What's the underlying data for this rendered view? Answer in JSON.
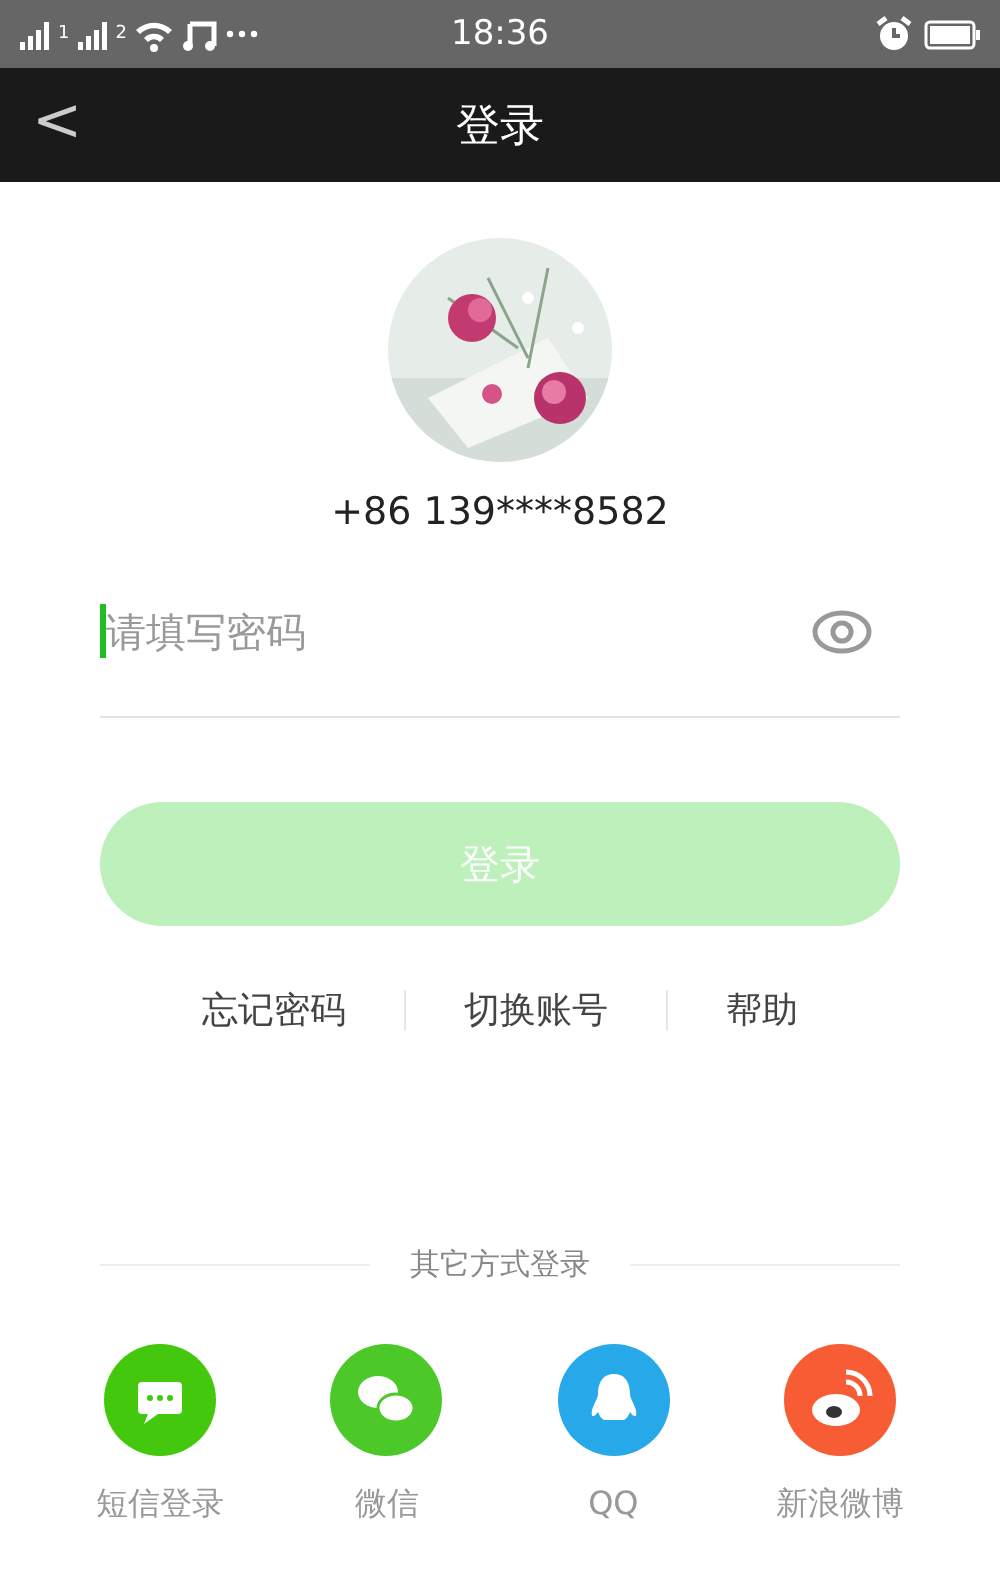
{
  "status_bar": {
    "sim_labels": [
      "1",
      "2"
    ],
    "time": "18:36"
  },
  "nav_bar": {
    "back": "<",
    "title": "登录"
  },
  "account": {
    "kind": "picture",
    "phone": "+86 139****8582"
  },
  "password_field": {
    "placeholder": "请填写密码",
    "focused": true
  },
  "login_button": {
    "label": "登录",
    "disabled": true
  },
  "links": [
    "忘记密码",
    "切换账号",
    "帮助"
  ],
  "other_login": {
    "title": "其它方式登录",
    "options": [
      {
        "kind": "sms",
        "label": "短信登录",
        "color": "#44c80e"
      },
      {
        "kind": "wechat",
        "label": "微信",
        "color": "#4cc928"
      },
      {
        "kind": "qq",
        "label": "QQ",
        "color": "#27a8e8"
      },
      {
        "kind": "weibo",
        "label": "新浪微博",
        "color": "#f75c35"
      }
    ]
  }
}
